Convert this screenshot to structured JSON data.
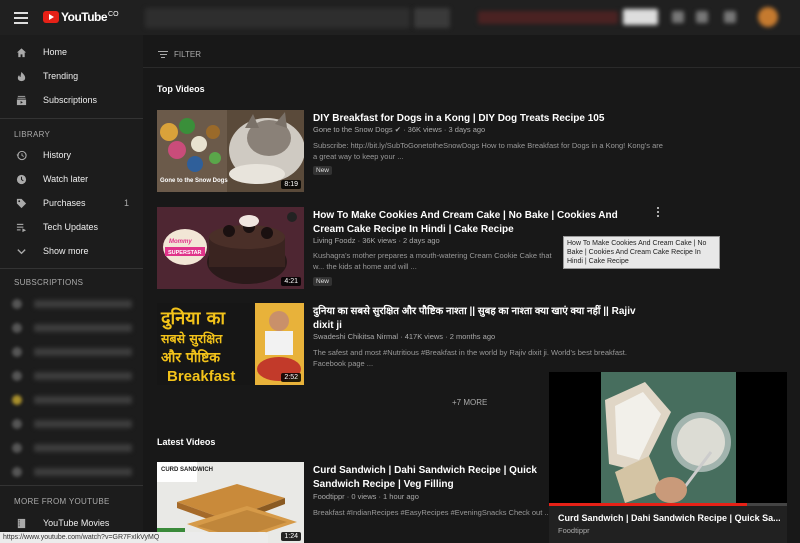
{
  "app": {
    "logo_text": "YouTube",
    "logo_sup": "CO"
  },
  "sidebar": {
    "main": [
      {
        "label": "Home",
        "icon": "home-icon"
      },
      {
        "label": "Trending",
        "icon": "flame-icon"
      },
      {
        "label": "Subscriptions",
        "icon": "subscriptions-icon"
      }
    ],
    "library_title": "LIBRARY",
    "library": [
      {
        "label": "History",
        "icon": "history-icon",
        "count": ""
      },
      {
        "label": "Watch later",
        "icon": "clock-icon",
        "count": ""
      },
      {
        "label": "Purchases",
        "icon": "tag-icon",
        "count": "1"
      },
      {
        "label": "Tech Updates",
        "icon": "playlist-icon",
        "count": ""
      },
      {
        "label": "Show more",
        "icon": "chevron-down-icon",
        "count": ""
      }
    ],
    "subscriptions_title": "SUBSCRIPTIONS",
    "more_title": "MORE FROM YOUTUBE",
    "more": [
      {
        "label": "YouTube Movies",
        "icon": "film-icon"
      }
    ]
  },
  "main": {
    "filter_label": "FILTER",
    "top_videos_title": "Top Videos",
    "more_label": "+7 MORE",
    "latest_videos_title": "Latest Videos",
    "videos": [
      {
        "title": "DIY Breakfast for Dogs in a Kong | DIY Dog Treats Recipe 105",
        "meta": "Gone to the Snow Dogs ✔ · 36K views · 3 days ago",
        "desc": "Subscribe: http://bit.ly/SubToGonetotheSnowDogs How to make Breakfast for Dogs in a Kong! Kong's are a great way to keep your ...",
        "badge": "New",
        "duration": "8:19",
        "thumb_caption": "Gone to the Snow Dogs"
      },
      {
        "title": "How To Make Cookies And Cream Cake | No Bake | Cookies And Cream Cake Recipe In Hindi | Cake Recipe",
        "meta": "Living Foodz · 36K views · 2 days ago",
        "desc": "Kushagra's mother prepares a mouth-watering Cream Cookie Cake that w... the kids at home and will ...",
        "badge": "New",
        "duration": "4:21",
        "thumb_caption": "Mommy SUPERSTAR"
      },
      {
        "title": "दुनिया का सबसे सुरक्षित और पौष्टिक नाश्ता || सुबह का नाश्ता क्या खाएं क्या नहीं || Rajiv dixit ji",
        "meta": "Swadeshi Chikitsa Nirmal · 417K views · 2 months ago",
        "desc": "The safest and most #Nutritious #Breakfast in the world by Rajiv dixit ji. World's best breakfast. Facebook page ...",
        "badge": "",
        "duration": "2:52",
        "thumb_lines": [
          "दुनिया का",
          "सबसे सुरक्षित",
          "और पौष्टिक",
          "Breakfast"
        ]
      },
      {
        "title": "Curd Sandwich | Dahi Sandwich Recipe | Quick Sandwich Recipe | Veg Filling",
        "meta": "Foodtippr · 0 views · 1 hour ago",
        "desc": "Breakfast #IndianRecipes #EasyRecipes #EveningSnacks Check out ...",
        "badge": "",
        "duration": "1:24",
        "thumb_caption": "CURD SANDWICH"
      }
    ],
    "tooltip": "How To Make Cookies And Cream Cake | No Bake | Cookies And Cream Cake Recipe In Hindi | Cake Recipe"
  },
  "miniplayer": {
    "title": "Curd Sandwich | Dahi Sandwich Recipe | Quick Sa...",
    "channel": "Foodtippr",
    "progress": 0.83
  },
  "status_url": "https://www.youtube.com/watch?v=GR7FxIkVyMQ"
}
